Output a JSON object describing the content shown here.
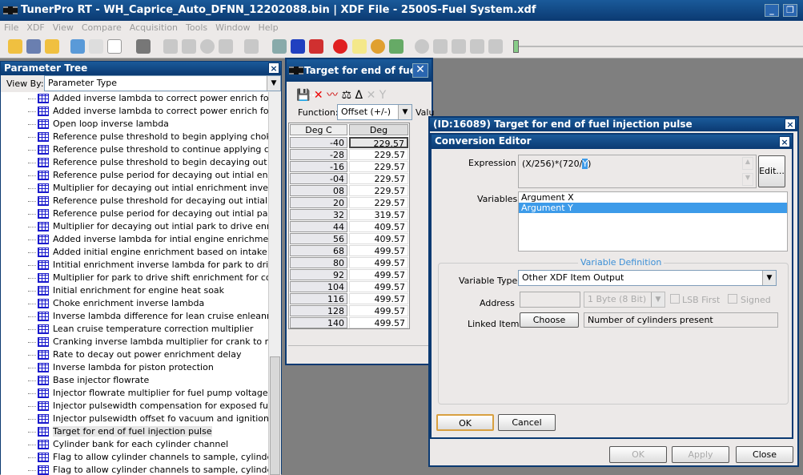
{
  "app": {
    "title": "TunerPro RT - WH_Caprice_Auto_DFNN_12202088.bin  |  XDF File - 2500S-Fuel System.xdf"
  },
  "menu": [
    "File",
    "XDF",
    "View",
    "Compare",
    "Acquisition",
    "Tools",
    "Window",
    "Help"
  ],
  "tree": {
    "title": "Parameter Tree",
    "view_by_label": "View By:",
    "view_by_value": "Parameter Type",
    "items": [
      "Added inverse lambda to correct power enrich for engin",
      "Added inverse lambda to correct power enrich for intake",
      "Open loop inverse lambda",
      "Reference pulse threshold to begin applying choke enric",
      "Reference pulse threshold to continue applying choke er",
      "Reference pulse threshold to begin decaying out initial e",
      "Reference pulse period for decaying out intial enrichmer",
      "Multiplier for decaying out intial enrichment inverse lamb",
      "Reference pulse threshold for decaying out intial park to",
      "Reference pulse period for decaying out intial park to dr",
      "Multiplier for decaying out intial park to drive enrichment",
      "Added inverse lambda for intial engine enrichment",
      "Added initial engine enrichment based on intake air temp",
      "Intitial enrichment inverse lambda for park to drive shift",
      "Multiplier for park to drive shift enrichment for compensa",
      "Initial enrichment for engine heat soak",
      "Choke enrichment inverse lambda",
      "Inverse lambda difference for lean cruise enleanment",
      "Lean cruise temperature correction multiplier",
      "Cranking inverse lambda multiplier for crank to run trans",
      "Rate to decay out power enrichment delay",
      "Inverse lambda for piston protection",
      "Base injector flowrate",
      "Injector flowrate multiplier for fuel pump voltage compe",
      "Injector pulsewidth compensation for exposed fuel in inj",
      "Injector pulsewidth offset fo vacuum and ignition voltag",
      "Target for end of fuel injection pulse",
      "Cylinder bank for each cylinder channel",
      "Flag to allow cylinder channels to sample, cylinder chann",
      "Flag to allow cylinder channels to sample, cylinder chann"
    ],
    "selected_index": 26
  },
  "table_window": {
    "title": "Target for end of fuel ...",
    "function_label": "Function:",
    "function_value": "Offset (+/-)",
    "value_label": "Valu",
    "col_x": "Deg C",
    "col_y": "Deg",
    "rows": [
      [
        "-40",
        "229.57"
      ],
      [
        "-28",
        "229.57"
      ],
      [
        "-16",
        "229.57"
      ],
      [
        "-04",
        "229.57"
      ],
      [
        "08",
        "229.57"
      ],
      [
        "20",
        "229.57"
      ],
      [
        "32",
        "319.57"
      ],
      [
        "44",
        "409.57"
      ],
      [
        "56",
        "409.57"
      ],
      [
        "68",
        "499.57"
      ],
      [
        "80",
        "499.57"
      ],
      [
        "92",
        "499.57"
      ],
      [
        "104",
        "499.57"
      ],
      [
        "116",
        "499.57"
      ],
      [
        "128",
        "499.57"
      ],
      [
        "140",
        "499.57"
      ]
    ]
  },
  "dialog": {
    "title": "(ID:16089) Target for end of fuel injection pulse",
    "ok": "OK",
    "apply": "Apply",
    "close": "Close"
  },
  "conv": {
    "title": "Conversion Editor",
    "expression_label": "Expression",
    "expression_pre": "(X/256)*(720/",
    "expression_sel": "Y",
    "expression_post": ")",
    "edit": "Edit...",
    "variables_label": "Variables",
    "variables": [
      "Argument X",
      "Argument Y"
    ],
    "selected_variable": 1,
    "vardef_label": "Variable Definition",
    "vartype_label": "Variable Type",
    "vartype_value": "Other XDF Item Output",
    "address_label": "Address",
    "address_value": "",
    "size_value": "1 Byte (8 Bit)",
    "lsb_label": "LSB First",
    "signed_label": "Signed",
    "linked_label": "Linked Item",
    "choose": "Choose",
    "linked_value": "Number of cylinders present",
    "ok": "OK",
    "cancel": "Cancel"
  },
  "colors": {
    "titlebar": "#0b3a72",
    "selection": "#3d9be9",
    "accent_label": "#3b8fd6"
  }
}
